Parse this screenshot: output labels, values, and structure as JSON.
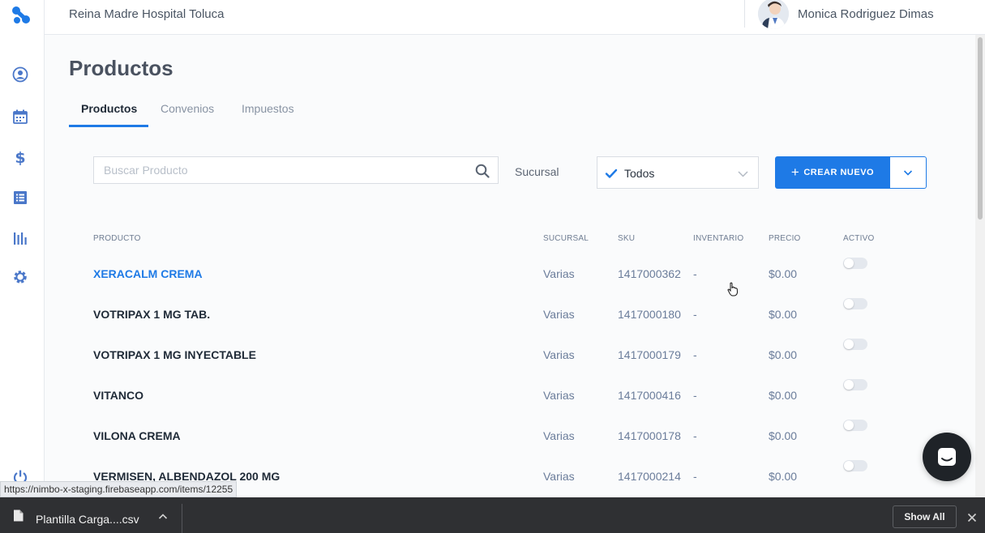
{
  "topbar": {
    "hospital_name": "Reina Madre Hospital Toluca",
    "user_name": "Monica Rodriguez Dimas"
  },
  "sidebar": {
    "icons": [
      "user-circle-icon",
      "calendar-icon",
      "dollar-icon",
      "list-icon",
      "bar-chart-icon",
      "gear-icon",
      "power-icon"
    ]
  },
  "page": {
    "title": "Productos",
    "tabs": [
      {
        "label": "Productos",
        "active": true
      },
      {
        "label": "Convenios",
        "active": false
      },
      {
        "label": "Impuestos",
        "active": false
      }
    ]
  },
  "filters": {
    "search_placeholder": "Buscar Producto",
    "sucursal_label": "Sucursal",
    "sucursal_value": "Todos",
    "create_button": "CREAR NUEVO"
  },
  "table": {
    "headers": [
      "PRODUCTO",
      "SUCURSAL",
      "SKU",
      "INVENTARIO",
      "PRECIO",
      "ACTIVO"
    ],
    "rows": [
      {
        "producto": "XERACALM CREMA",
        "sucursal": "Varias",
        "sku": "1417000362",
        "inventario": "-",
        "precio": "$0.00",
        "activo": false
      },
      {
        "producto": "VOTRIPAX 1 MG TAB.",
        "sucursal": "Varias",
        "sku": "1417000180",
        "inventario": "-",
        "precio": "$0.00",
        "activo": false
      },
      {
        "producto": "VOTRIPAX 1 MG INYECTABLE",
        "sucursal": "Varias",
        "sku": "1417000179",
        "inventario": "-",
        "precio": "$0.00",
        "activo": false
      },
      {
        "producto": "VITANCO",
        "sucursal": "Varias",
        "sku": "1417000416",
        "inventario": "-",
        "precio": "$0.00",
        "activo": false
      },
      {
        "producto": "VILONA CREMA",
        "sucursal": "Varias",
        "sku": "1417000178",
        "inventario": "-",
        "precio": "$0.00",
        "activo": false
      },
      {
        "producto": "VERMISEN, ALBENDAZOL 200 MG",
        "sucursal": "Varias",
        "sku": "1417000214",
        "inventario": "-",
        "precio": "$0.00",
        "activo": false
      }
    ]
  },
  "status_url": "https://nimbo-x-staging.firebaseapp.com/items/12255",
  "downloads": {
    "file_name": "Plantilla Carga....csv",
    "show_all": "Show All"
  },
  "colors": {
    "accent": "#1e7ae6",
    "download_bar": "#2f3033",
    "chat_bubble": "#1f2328"
  }
}
